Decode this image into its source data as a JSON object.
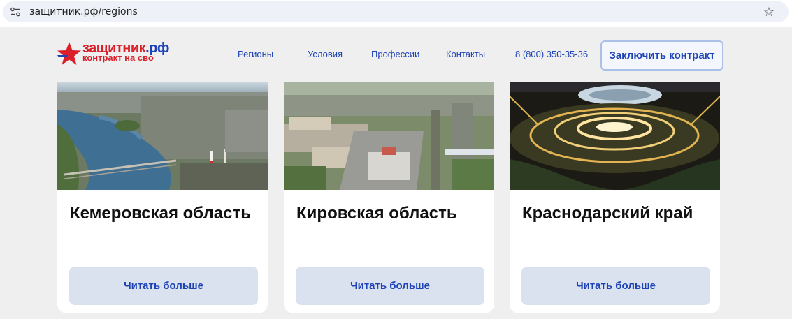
{
  "browser": {
    "url": "защитник.рф/regions",
    "site_info_icon": "site-settings-icon",
    "bookmark_icon": "star-icon"
  },
  "header": {
    "logo": {
      "name_main": "защитник",
      "name_suffix": ".рф",
      "subtitle": "контракт на сво"
    },
    "nav": [
      "Регионы",
      "Условия",
      "Профессии",
      "Контакты"
    ],
    "phone": "8 (800) 350-35-36",
    "cta": "Заключить контракт"
  },
  "regions": [
    {
      "title": "Кемеровская область",
      "button": "Читать больше"
    },
    {
      "title": "Кировская область",
      "button": "Читать больше"
    },
    {
      "title": "Краснодарский край",
      "button": "Читать больше"
    }
  ],
  "colors": {
    "brand_blue": "#1d43b6",
    "brand_red": "#d91f2a",
    "page_bg": "#efefef",
    "button_bg": "#dbe2ef"
  }
}
